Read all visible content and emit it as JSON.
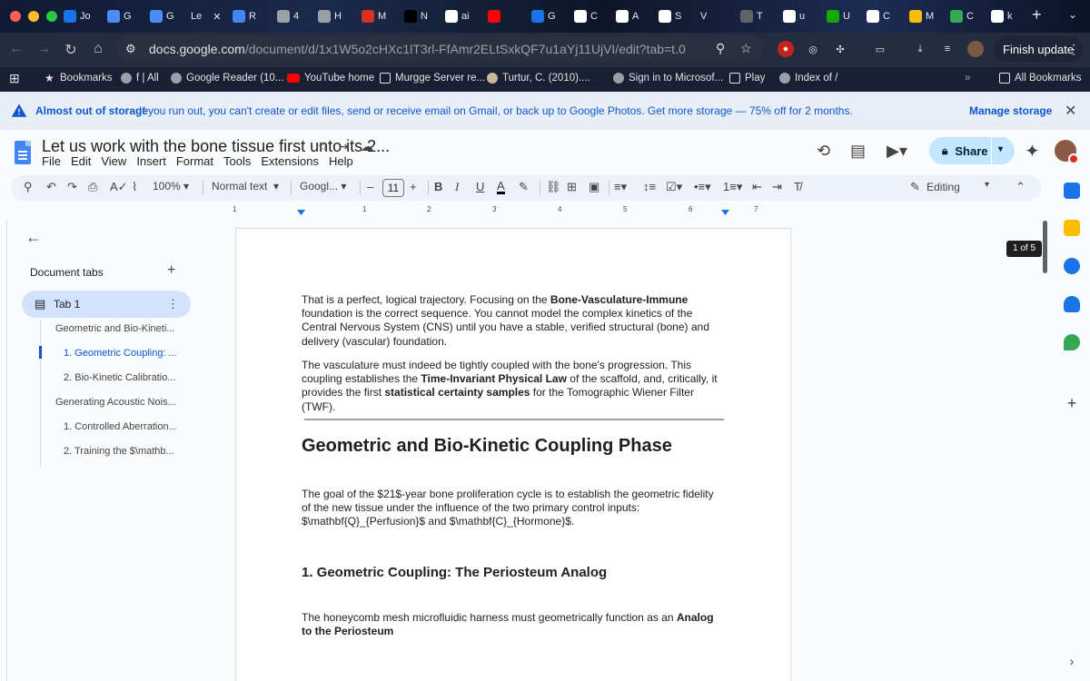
{
  "browser": {
    "tabs": [
      {
        "label": "Jo",
        "icon": "calendar-icon",
        "color": "#1a73e8"
      },
      {
        "label": "G",
        "icon": "gemini-icon",
        "color": "#4c8df6"
      },
      {
        "label": "G",
        "icon": "gemini-icon",
        "color": "#4c8df6"
      },
      {
        "label": "Le",
        "icon": "",
        "color": ""
      },
      {
        "label": "R",
        "icon": "docs-icon",
        "color": "#4285f4"
      },
      {
        "label": "4",
        "icon": "globe-icon",
        "color": "#9aa0a6"
      },
      {
        "label": "H",
        "icon": "globe-icon",
        "color": "#9aa0a6"
      },
      {
        "label": "M",
        "icon": "arc-icon",
        "color": "#d93025"
      },
      {
        "label": "N",
        "icon": "x-icon",
        "color": "#000000"
      },
      {
        "label": "ai",
        "icon": "google-icon",
        "color": "#ffffff"
      },
      {
        "label": "",
        "icon": "youtube-icon",
        "color": "#ff0000"
      },
      {
        "label": "G",
        "icon": "calendar-icon",
        "color": "#1a73e8"
      },
      {
        "label": "C",
        "icon": "wikipedia-icon",
        "color": "#ffffff"
      },
      {
        "label": "A",
        "icon": "grid-icon",
        "color": "#ffffff"
      },
      {
        "label": "S",
        "icon": "google-icon",
        "color": "#ffffff"
      },
      {
        "label": "V",
        "icon": "",
        "color": ""
      },
      {
        "label": "T",
        "icon": "play-icon",
        "color": "#5f6368"
      },
      {
        "label": "u",
        "icon": "google-icon",
        "color": "#ffffff"
      },
      {
        "label": "U",
        "icon": "upwork-icon",
        "color": "#14a800"
      },
      {
        "label": "C",
        "icon": "google-icon",
        "color": "#ffffff"
      },
      {
        "label": "M",
        "icon": "drive-icon",
        "color": "#fbbc04"
      },
      {
        "label": "C",
        "icon": "maps-icon",
        "color": "#34a853"
      },
      {
        "label": "k",
        "icon": "google-icon",
        "color": "#ffffff"
      }
    ],
    "close_glyph": "✕",
    "new_tab_glyph": "+",
    "url_domain": "docs.google.com",
    "url_path": "/document/d/1x1W5o2cHXc1lT3rl-FfAmr2ELtSxkQF7u1aYj11UjVI/edit?tab=t.0",
    "finish_update": "Finish update",
    "bookmarks": [
      {
        "label": "Bookmarks",
        "icon": "star-icon"
      },
      {
        "label": "f | All",
        "icon": "globe-icon"
      },
      {
        "label": "Google Reader (10...",
        "icon": "globe-icon"
      },
      {
        "label": "YouTube home",
        "icon": "youtube-icon"
      },
      {
        "label": "Murgge Server re...",
        "icon": "folder-icon"
      },
      {
        "label": "Turtur, C. (2010)....",
        "icon": "image-icon"
      },
      {
        "label": "Sign in to Microsof...",
        "icon": "globe-icon"
      },
      {
        "label": "Play",
        "icon": "folder-icon"
      },
      {
        "label": "Index of /",
        "icon": "globe-icon"
      },
      {
        "label": "All Bookmarks",
        "icon": "folder-icon"
      }
    ]
  },
  "banner": {
    "title": "Almost out of storage",
    "message": "If you run out, you can't create or edit files, send or receive email on Gmail, or back up to Google Photos. Get more storage — 75% off for 2 months.",
    "action": "Manage storage"
  },
  "doc": {
    "title": "Let us work with the bone tissue first unto its 2...",
    "menu": [
      "File",
      "Edit",
      "View",
      "Insert",
      "Format",
      "Tools",
      "Extensions",
      "Help"
    ],
    "share": "Share",
    "zoom": "100%",
    "style": "Normal text",
    "font": "Googl...",
    "font_size": "11",
    "mode": "Editing",
    "page_count": "1 of 5"
  },
  "ruler": [
    "1",
    "1",
    "2",
    "3",
    "4",
    "5",
    "6",
    "7"
  ],
  "sidebar": {
    "heading": "Document tabs",
    "tab_label": "Tab 1",
    "outline": [
      {
        "label": "Geometric and Bio-Kineti...",
        "level": 1,
        "active": false
      },
      {
        "label": "1. Geometric Coupling: ...",
        "level": 2,
        "active": true
      },
      {
        "label": "2. Bio-Kinetic Calibratio...",
        "level": 2,
        "active": false
      },
      {
        "label": "Generating Acoustic Nois...",
        "level": 1,
        "active": false
      },
      {
        "label": "1. Controlled Aberration...",
        "level": 2,
        "active": false
      },
      {
        "label": "2. Training the $\\mathb...",
        "level": 2,
        "active": false
      }
    ]
  },
  "content": {
    "p1": [
      {
        "t": "That is a perfect, logical trajectory. Focusing on the ",
        "b": false
      },
      {
        "t": "Bone-Vasculature-Immune",
        "b": true
      },
      {
        "t": " foundation is the correct sequence. You cannot model the complex kinetics of the Central Nervous System (CNS) until you have a stable, verified structural (bone) and delivery (vascular) foundation.",
        "b": false
      }
    ],
    "p2": [
      {
        "t": "The vasculature must indeed be tightly coupled with the bone's progression. This coupling establishes the ",
        "b": false
      },
      {
        "t": "Time-Invariant Physical Law",
        "b": true
      },
      {
        "t": " of the scaffold, and, critically, it provides the first ",
        "b": false
      },
      {
        "t": "statistical certainty samples",
        "b": true
      },
      {
        "t": " for the Tomographic Wiener Filter (TWF).",
        "b": false
      }
    ],
    "h1": "Geometric and Bio-Kinetic Coupling Phase",
    "p3": [
      {
        "t": "The goal of the $21$-year bone proliferation cycle is to establish the geometric fidelity of the new tissue under the influence of the two primary control inputs: $\\mathbf{Q}_{Perfusion}$ and $\\mathbf{C}_{Hormone}$.",
        "b": false
      }
    ],
    "h2": "1. Geometric Coupling: The Periosteum Analog",
    "p4": [
      {
        "t": "The honeycomb mesh microfluidic harness must geometrically function as an ",
        "b": false
      },
      {
        "t": "Analog to the Periosteum",
        "b": true
      }
    ]
  }
}
